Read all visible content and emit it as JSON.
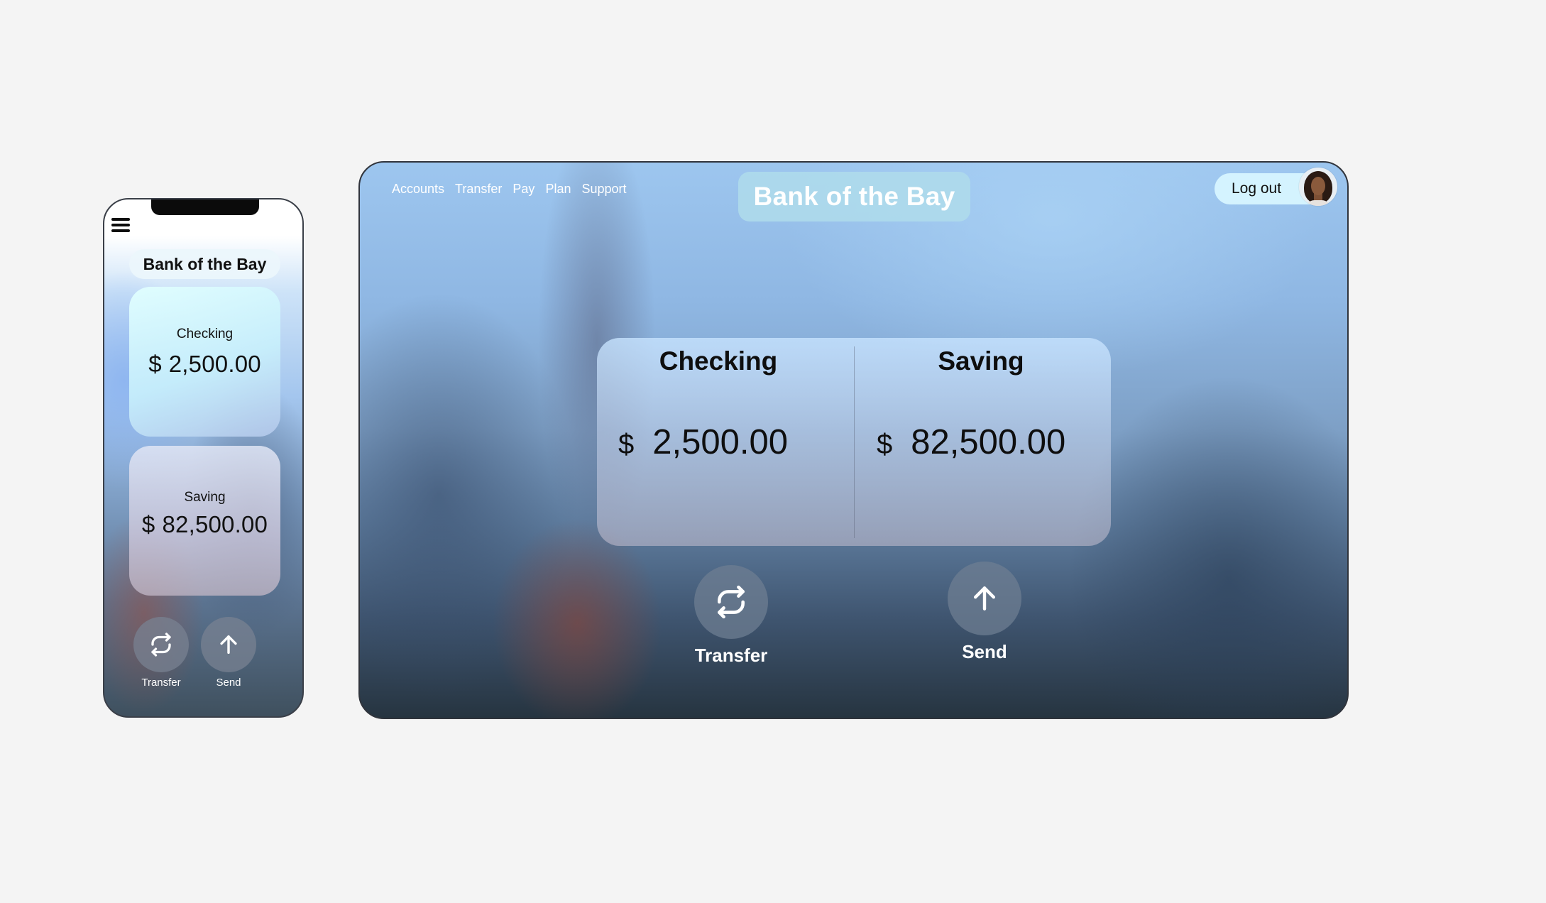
{
  "brand": {
    "name": "Bank of the Bay"
  },
  "mobile": {
    "menu_icon": "hamburger-menu-icon",
    "accounts": [
      {
        "label": "Checking",
        "currency": "$",
        "amount": "2,500.00"
      },
      {
        "label": "Saving",
        "currency": "$",
        "amount": "82,500.00"
      }
    ],
    "actions": [
      {
        "label": "Transfer",
        "icon": "transfer-icon"
      },
      {
        "label": "Send",
        "icon": "send-arrow-up-icon"
      }
    ]
  },
  "desktop": {
    "nav": [
      "Accounts",
      "Transfer",
      "Pay",
      "Plan",
      "Support"
    ],
    "logout_label": "Log out",
    "avatar_icon": "user-avatar",
    "accounts": [
      {
        "label": "Checking",
        "currency": "$",
        "amount": "2,500.00"
      },
      {
        "label": "Saving",
        "currency": "$",
        "amount": "82,500.00"
      }
    ],
    "actions": [
      {
        "label": "Transfer",
        "icon": "transfer-icon"
      },
      {
        "label": "Send",
        "icon": "send-arrow-up-icon"
      }
    ]
  },
  "colors": {
    "page_background": "#f4f4f4",
    "brand_pill": "#aedcea",
    "logout_pill": "#d7f5ff",
    "action_circle": "#6e7d91"
  }
}
